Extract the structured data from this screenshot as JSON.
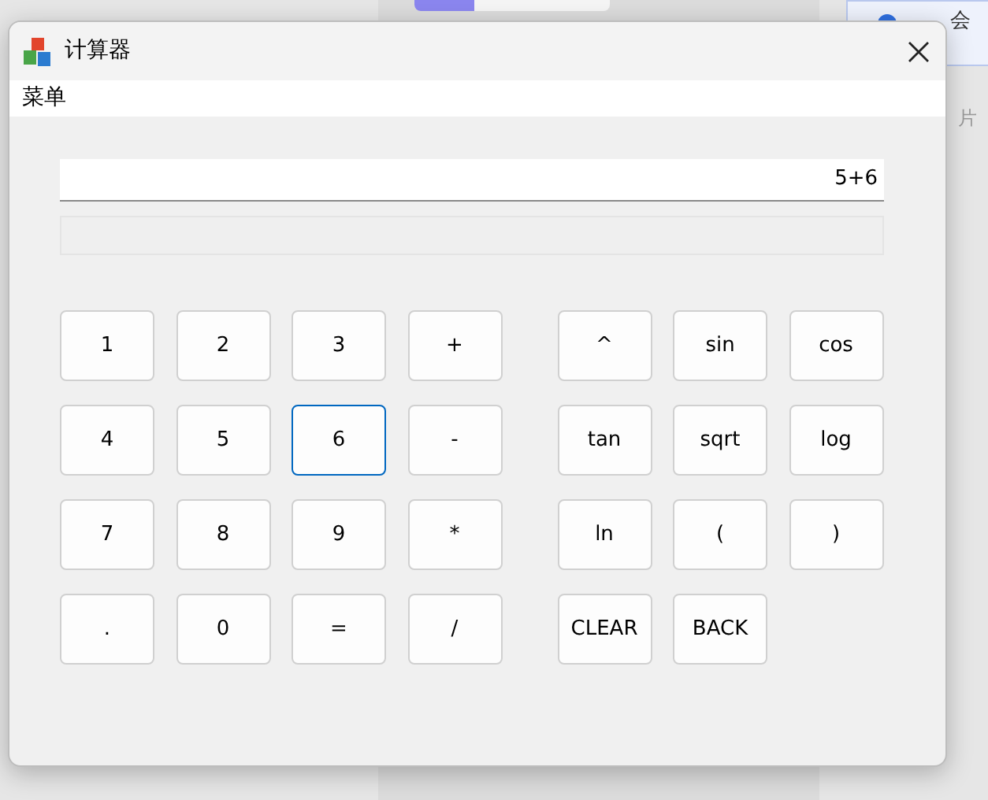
{
  "background": {
    "texts": [
      "会",
      "片"
    ],
    "progress": {
      "level": 0.31
    }
  },
  "window": {
    "title": "计算器"
  },
  "menu_bar": {
    "items": [
      "菜单"
    ]
  },
  "display": {
    "expression": "5+6"
  },
  "keypad_left": [
    {
      "label": "1",
      "focused": false
    },
    {
      "label": "2",
      "focused": false
    },
    {
      "label": "3",
      "focused": false
    },
    {
      "label": "+",
      "focused": false
    },
    {
      "label": "4",
      "focused": false
    },
    {
      "label": "5",
      "focused": false
    },
    {
      "label": "6",
      "focused": true
    },
    {
      "label": "-",
      "focused": false
    },
    {
      "label": "7",
      "focused": false
    },
    {
      "label": "8",
      "focused": false
    },
    {
      "label": "9",
      "focused": false
    },
    {
      "label": "*",
      "focused": false
    },
    {
      "label": ".",
      "focused": false
    },
    {
      "label": "0",
      "focused": false
    },
    {
      "label": "=",
      "focused": false
    },
    {
      "label": "/",
      "focused": false
    }
  ],
  "keypad_right": [
    {
      "label": "^",
      "focused": false
    },
    {
      "label": "sin",
      "focused": false
    },
    {
      "label": "cos",
      "focused": false
    },
    {
      "label": "tan",
      "focused": false
    },
    {
      "label": "sqrt",
      "focused": false
    },
    {
      "label": "log",
      "focused": false
    },
    {
      "label": "ln",
      "focused": false
    },
    {
      "label": "(",
      "focused": false
    },
    {
      "label": ")",
      "focused": false
    },
    {
      "label": "CLEAR",
      "focused": false
    },
    {
      "label": "BACK",
      "focused": false
    }
  ]
}
